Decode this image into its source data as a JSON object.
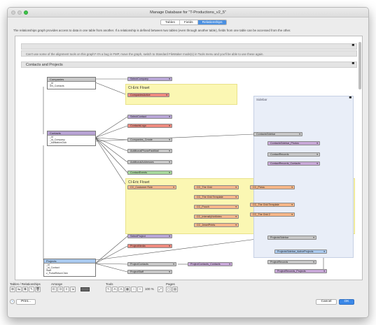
{
  "window": {
    "title": "Manage Database for “T-Productions_v2_5”"
  },
  "tabs": [
    {
      "label": "Tables"
    },
    {
      "label": "Fields"
    },
    {
      "label": "Relationships",
      "active": true
    }
  ],
  "description": "The relationships graph provides access to data in one table from another. If a relationship is defined between two tables (even through another table), fields from one table can be accessed from the other.",
  "graph": {
    "note_alignment": "Can't use some of the alignment tools on this graph? It's a bug in FMP, move the graph, switch to Standard FileMaker mode(s) in Tools menu and you'll be able to use these again.",
    "section_contacts_projects": "Contacts and Projects",
    "sidebar_label": "Sidebar",
    "sticky_1": "CI-Eric Flouet",
    "sticky_2": "CI-Eric Flouet",
    "tables": {
      "companies": {
        "title": "Companies",
        "fields": [
          "_id",
          "SN_Contacts"
        ]
      },
      "contacts": {
        "title": "Contacts",
        "fields": [
          "_id",
          "_id_Company",
          "_kAfiliationClub"
        ]
      },
      "projects": {
        "title": "Projects",
        "fields": [
          "_id",
          "_id_Contact",
          "Staff",
          "z_PortalReturnClick"
        ]
      }
    },
    "occurrences": {
      "select_company": "SelectCompany",
      "companies_active": "CompaniesActive",
      "select_contact": "SelectContact",
      "contacts_logo": "ContactsLogo",
      "companies_create": "Companies_Create",
      "additional_phone": "AdditionalPhoneFastMail",
      "additional_addresses": "AdditionalAddresses",
      "contact_events": "ContactEvents",
      "cc_customer_role": "CC_Customer Role",
      "cc_the_grid": "CC_The Grid",
      "cc_the_grid_template": "CC_The Grid Template",
      "cc_pouch": "CC_Pouch",
      "cc_intensify": "CC_IntensifyNoMotec",
      "cc_jewelries": "CC_JewelPrints",
      "cc_press": "CC_Press",
      "cc_grid_template_2": "CC_The Grid Template",
      "cc_grid_2": "CC_The Grid 2",
      "contacts_sidebar": "ContactsSidebar",
      "contacts_sidebar_photos": "ContactsSidebar_Photos",
      "contact_records": "ContactRecords",
      "contact_records_contacts": "ContactRecords_Contacts",
      "select_project": "SelectProject",
      "project_media": "ProjectMedia",
      "project_contacts": "ProjectContacts",
      "project_contacts_contacts": "ProjectContacts_Contacts",
      "project_staff": "ProjectStaff",
      "projects_sidebar": "ProjectsSidebar",
      "projects_sidebar_active": "ProjectsSidebar_ActiveProjects",
      "project_records": "ProjectRecords",
      "project_records_projects": "ProjectRecords_Projects"
    }
  },
  "bottom": {
    "tables_group_label": "Tables / Relationships",
    "arrange_label": "Arrange",
    "tools_label": "Tools",
    "pages_label": "Pages",
    "zoom": "100 %",
    "print_label": "Print...",
    "cancel_label": "Cancel",
    "ok_label": "OK",
    "help_label": "?"
  }
}
